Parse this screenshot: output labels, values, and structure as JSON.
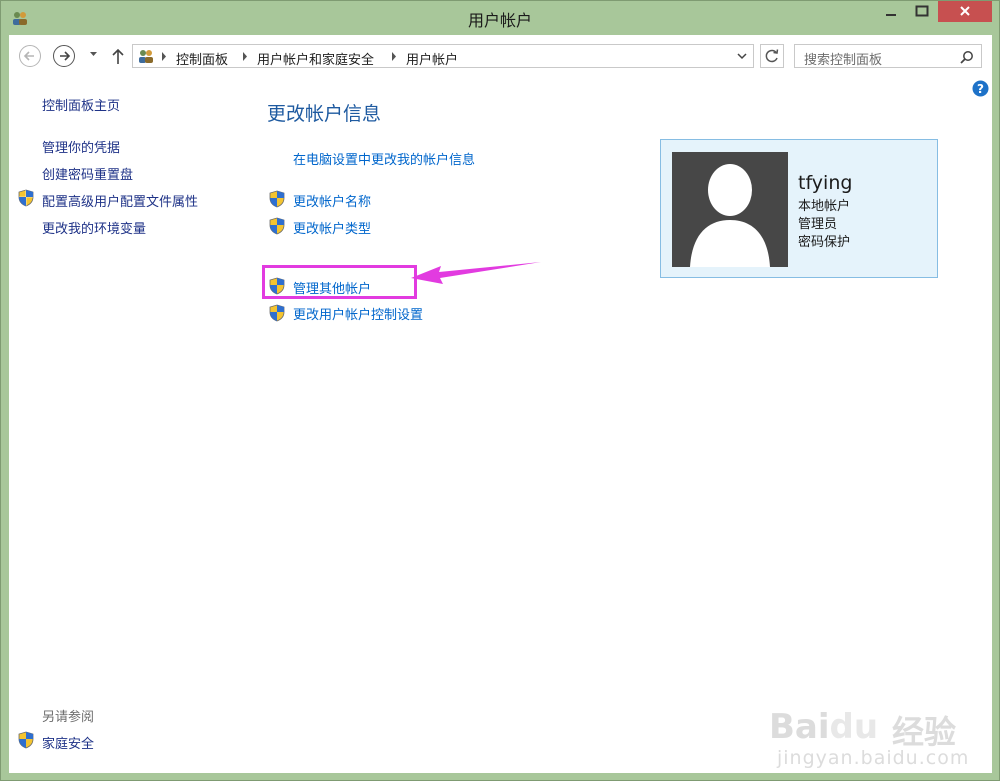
{
  "window": {
    "title": "用户帐户"
  },
  "colors": {
    "accent": "#0066cc",
    "highlight": "#e23be0",
    "close": "#c75050",
    "card_bg": "#e5f3fb"
  },
  "address": {
    "crumbs": [
      "控制面板",
      "用户帐户和家庭安全",
      "用户帐户"
    ],
    "search_placeholder": "搜索控制面板"
  },
  "sidebar": {
    "home": "控制面板主页",
    "items": [
      {
        "label": "管理你的凭据",
        "icon": ""
      },
      {
        "label": "创建密码重置盘",
        "icon": ""
      },
      {
        "label": "配置高级用户配置文件属性",
        "icon": "shield-icon"
      },
      {
        "label": "更改我的环境变量",
        "icon": ""
      }
    ],
    "see_also_label": "另请参阅",
    "see_also_items": [
      {
        "label": "家庭安全",
        "icon": "shield-icon"
      }
    ]
  },
  "main": {
    "title": "更改帐户信息",
    "pc_settings_link": "在电脑设置中更改我的帐户信息",
    "links": [
      {
        "label": "更改帐户名称",
        "icon": "shield-icon"
      },
      {
        "label": "更改帐户类型",
        "icon": "shield-icon"
      },
      {
        "label": "管理其他帐户",
        "icon": "shield-icon"
      },
      {
        "label": "更改用户帐户控制设置",
        "icon": "shield-icon"
      }
    ]
  },
  "account": {
    "username": "tfying",
    "type": "本地帐户",
    "role": "管理员",
    "protection": "密码保护"
  },
  "watermark": {
    "brand": "Bai",
    "brand2": "du",
    "cn": "经验",
    "url": "jingyan.baidu.com"
  }
}
